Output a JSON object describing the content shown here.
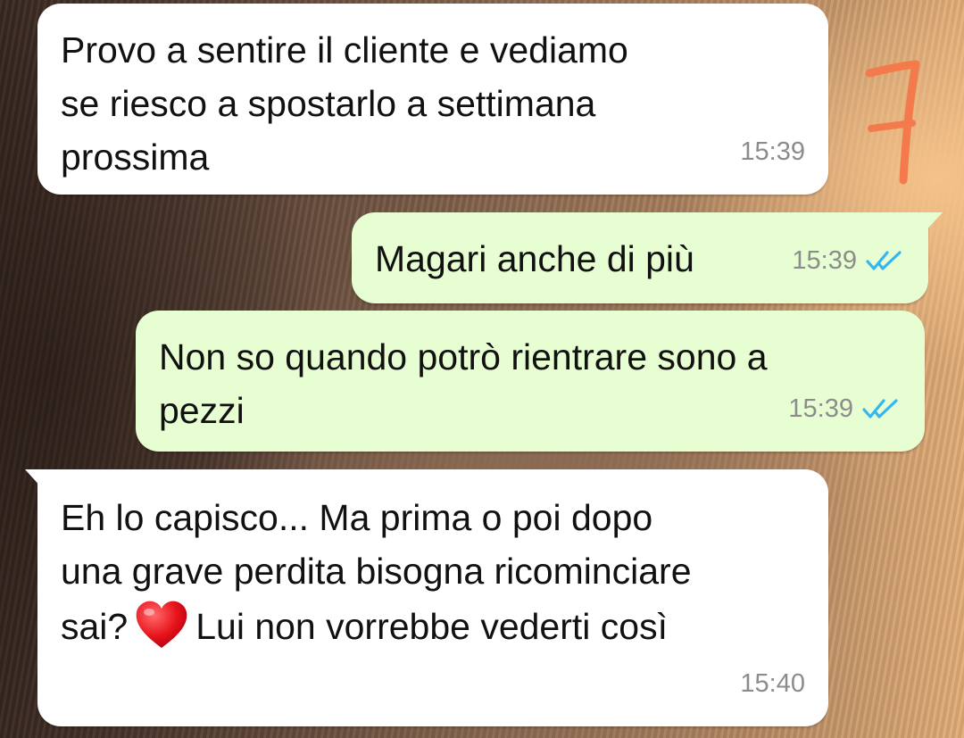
{
  "messages": [
    {
      "direction": "incoming",
      "lines": [
        "Provo a sentire il cliente e vediamo",
        "se riesco a spostarlo a settimana",
        "prossima"
      ],
      "time": "15:39"
    },
    {
      "direction": "outgoing",
      "lines": [
        "Magari anche di più"
      ],
      "time": "15:39",
      "status": "read"
    },
    {
      "direction": "outgoing",
      "lines": [
        "Non so quando potrò rientrare sono a",
        "pezzi"
      ],
      "time": "15:39",
      "status": "read"
    },
    {
      "direction": "incoming",
      "lines": [
        "Eh lo capisco... Ma prima o poi dopo",
        "una grave perdita bisogna ricominciare"
      ],
      "line3_before_emoji": "sai?",
      "emoji": "heart-emoji",
      "line3_after_emoji": "Lui non vorrebbe vederti così",
      "time": "15:40"
    }
  ],
  "annotation_text": "7",
  "colors": {
    "incoming_bubble": "#ffffff",
    "outgoing_bubble": "#e7fdd2",
    "read_tick": "#34b7f1",
    "annotation": "#f47a4c",
    "timestamp": "#8c8c8c"
  }
}
